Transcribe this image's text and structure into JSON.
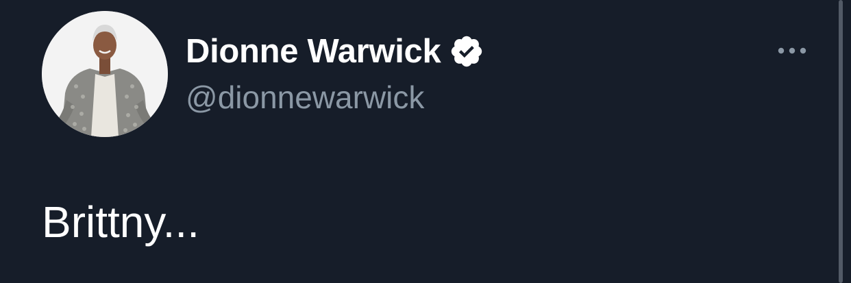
{
  "tweet": {
    "author": {
      "display_name": "Dionne Warwick",
      "handle": "@dionnewarwick",
      "verified": true
    },
    "text": "Brittny...",
    "more_icon": "more-horizontal-icon"
  },
  "colors": {
    "background": "#161d29",
    "primary_text": "#ffffff",
    "secondary_text": "#8b98a5"
  }
}
